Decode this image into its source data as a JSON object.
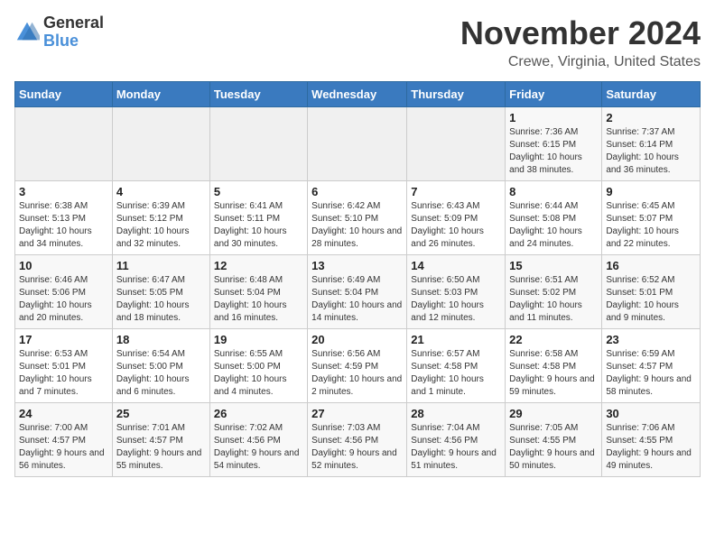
{
  "logo": {
    "general": "General",
    "blue": "Blue"
  },
  "header": {
    "month": "November 2024",
    "location": "Crewe, Virginia, United States"
  },
  "weekdays": [
    "Sunday",
    "Monday",
    "Tuesday",
    "Wednesday",
    "Thursday",
    "Friday",
    "Saturday"
  ],
  "weeks": [
    [
      {
        "day": "",
        "sunrise": "",
        "sunset": "",
        "daylight": ""
      },
      {
        "day": "",
        "sunrise": "",
        "sunset": "",
        "daylight": ""
      },
      {
        "day": "",
        "sunrise": "",
        "sunset": "",
        "daylight": ""
      },
      {
        "day": "",
        "sunrise": "",
        "sunset": "",
        "daylight": ""
      },
      {
        "day": "",
        "sunrise": "",
        "sunset": "",
        "daylight": ""
      },
      {
        "day": "1",
        "sunrise": "Sunrise: 7:36 AM",
        "sunset": "Sunset: 6:15 PM",
        "daylight": "Daylight: 10 hours and 38 minutes."
      },
      {
        "day": "2",
        "sunrise": "Sunrise: 7:37 AM",
        "sunset": "Sunset: 6:14 PM",
        "daylight": "Daylight: 10 hours and 36 minutes."
      }
    ],
    [
      {
        "day": "3",
        "sunrise": "Sunrise: 6:38 AM",
        "sunset": "Sunset: 5:13 PM",
        "daylight": "Daylight: 10 hours and 34 minutes."
      },
      {
        "day": "4",
        "sunrise": "Sunrise: 6:39 AM",
        "sunset": "Sunset: 5:12 PM",
        "daylight": "Daylight: 10 hours and 32 minutes."
      },
      {
        "day": "5",
        "sunrise": "Sunrise: 6:41 AM",
        "sunset": "Sunset: 5:11 PM",
        "daylight": "Daylight: 10 hours and 30 minutes."
      },
      {
        "day": "6",
        "sunrise": "Sunrise: 6:42 AM",
        "sunset": "Sunset: 5:10 PM",
        "daylight": "Daylight: 10 hours and 28 minutes."
      },
      {
        "day": "7",
        "sunrise": "Sunrise: 6:43 AM",
        "sunset": "Sunset: 5:09 PM",
        "daylight": "Daylight: 10 hours and 26 minutes."
      },
      {
        "day": "8",
        "sunrise": "Sunrise: 6:44 AM",
        "sunset": "Sunset: 5:08 PM",
        "daylight": "Daylight: 10 hours and 24 minutes."
      },
      {
        "day": "9",
        "sunrise": "Sunrise: 6:45 AM",
        "sunset": "Sunset: 5:07 PM",
        "daylight": "Daylight: 10 hours and 22 minutes."
      }
    ],
    [
      {
        "day": "10",
        "sunrise": "Sunrise: 6:46 AM",
        "sunset": "Sunset: 5:06 PM",
        "daylight": "Daylight: 10 hours and 20 minutes."
      },
      {
        "day": "11",
        "sunrise": "Sunrise: 6:47 AM",
        "sunset": "Sunset: 5:05 PM",
        "daylight": "Daylight: 10 hours and 18 minutes."
      },
      {
        "day": "12",
        "sunrise": "Sunrise: 6:48 AM",
        "sunset": "Sunset: 5:04 PM",
        "daylight": "Daylight: 10 hours and 16 minutes."
      },
      {
        "day": "13",
        "sunrise": "Sunrise: 6:49 AM",
        "sunset": "Sunset: 5:04 PM",
        "daylight": "Daylight: 10 hours and 14 minutes."
      },
      {
        "day": "14",
        "sunrise": "Sunrise: 6:50 AM",
        "sunset": "Sunset: 5:03 PM",
        "daylight": "Daylight: 10 hours and 12 minutes."
      },
      {
        "day": "15",
        "sunrise": "Sunrise: 6:51 AM",
        "sunset": "Sunset: 5:02 PM",
        "daylight": "Daylight: 10 hours and 11 minutes."
      },
      {
        "day": "16",
        "sunrise": "Sunrise: 6:52 AM",
        "sunset": "Sunset: 5:01 PM",
        "daylight": "Daylight: 10 hours and 9 minutes."
      }
    ],
    [
      {
        "day": "17",
        "sunrise": "Sunrise: 6:53 AM",
        "sunset": "Sunset: 5:01 PM",
        "daylight": "Daylight: 10 hours and 7 minutes."
      },
      {
        "day": "18",
        "sunrise": "Sunrise: 6:54 AM",
        "sunset": "Sunset: 5:00 PM",
        "daylight": "Daylight: 10 hours and 6 minutes."
      },
      {
        "day": "19",
        "sunrise": "Sunrise: 6:55 AM",
        "sunset": "Sunset: 5:00 PM",
        "daylight": "Daylight: 10 hours and 4 minutes."
      },
      {
        "day": "20",
        "sunrise": "Sunrise: 6:56 AM",
        "sunset": "Sunset: 4:59 PM",
        "daylight": "Daylight: 10 hours and 2 minutes."
      },
      {
        "day": "21",
        "sunrise": "Sunrise: 6:57 AM",
        "sunset": "Sunset: 4:58 PM",
        "daylight": "Daylight: 10 hours and 1 minute."
      },
      {
        "day": "22",
        "sunrise": "Sunrise: 6:58 AM",
        "sunset": "Sunset: 4:58 PM",
        "daylight": "Daylight: 9 hours and 59 minutes."
      },
      {
        "day": "23",
        "sunrise": "Sunrise: 6:59 AM",
        "sunset": "Sunset: 4:57 PM",
        "daylight": "Daylight: 9 hours and 58 minutes."
      }
    ],
    [
      {
        "day": "24",
        "sunrise": "Sunrise: 7:00 AM",
        "sunset": "Sunset: 4:57 PM",
        "daylight": "Daylight: 9 hours and 56 minutes."
      },
      {
        "day": "25",
        "sunrise": "Sunrise: 7:01 AM",
        "sunset": "Sunset: 4:57 PM",
        "daylight": "Daylight: 9 hours and 55 minutes."
      },
      {
        "day": "26",
        "sunrise": "Sunrise: 7:02 AM",
        "sunset": "Sunset: 4:56 PM",
        "daylight": "Daylight: 9 hours and 54 minutes."
      },
      {
        "day": "27",
        "sunrise": "Sunrise: 7:03 AM",
        "sunset": "Sunset: 4:56 PM",
        "daylight": "Daylight: 9 hours and 52 minutes."
      },
      {
        "day": "28",
        "sunrise": "Sunrise: 7:04 AM",
        "sunset": "Sunset: 4:56 PM",
        "daylight": "Daylight: 9 hours and 51 minutes."
      },
      {
        "day": "29",
        "sunrise": "Sunrise: 7:05 AM",
        "sunset": "Sunset: 4:55 PM",
        "daylight": "Daylight: 9 hours and 50 minutes."
      },
      {
        "day": "30",
        "sunrise": "Sunrise: 7:06 AM",
        "sunset": "Sunset: 4:55 PM",
        "daylight": "Daylight: 9 hours and 49 minutes."
      }
    ]
  ]
}
